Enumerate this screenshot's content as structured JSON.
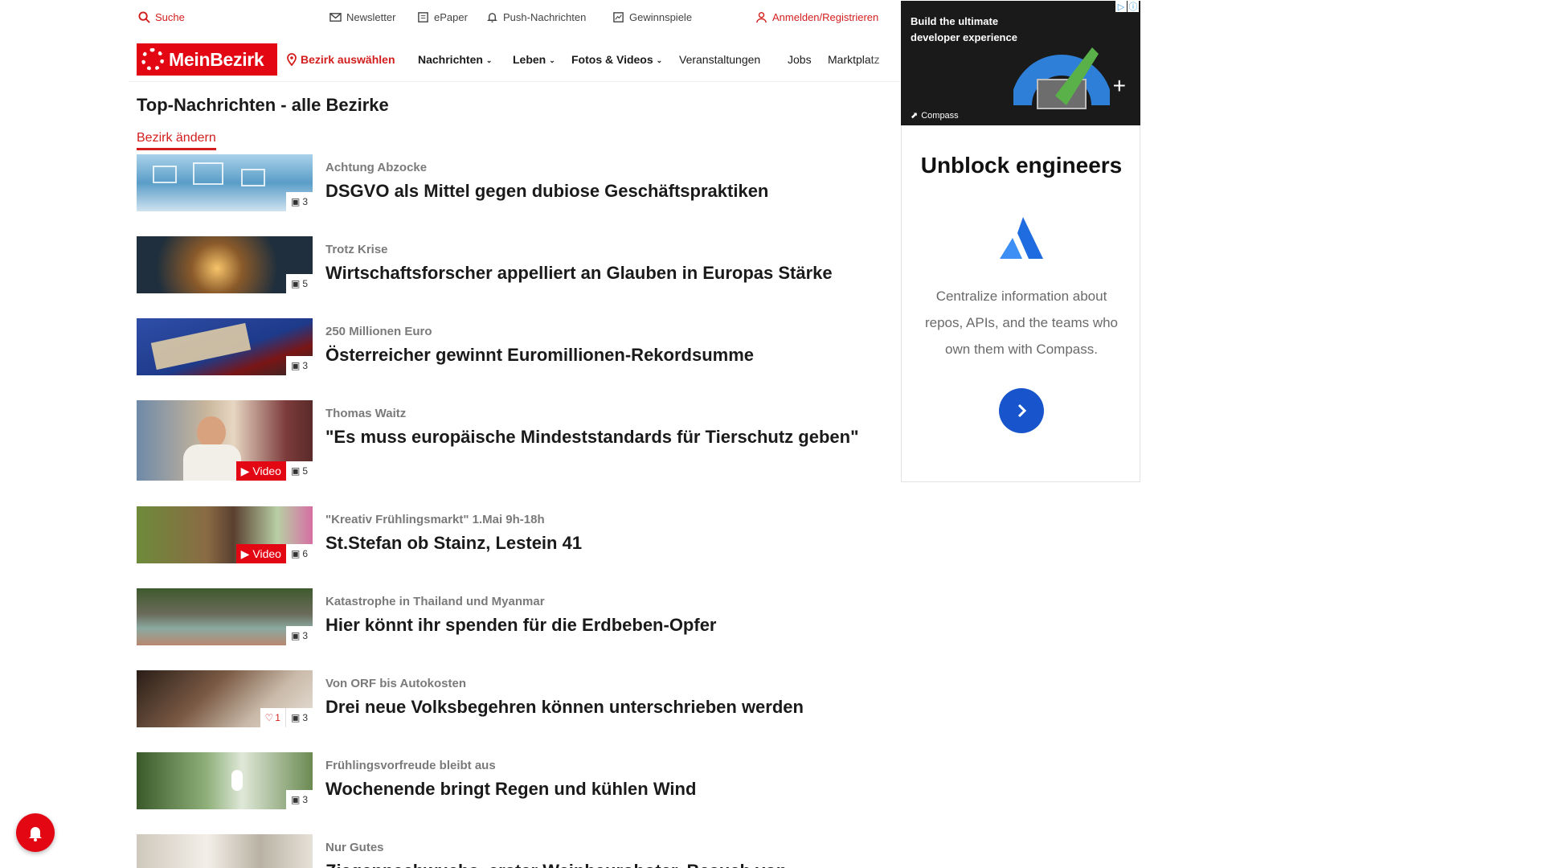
{
  "header": {
    "search_label": "Suche",
    "newsletter_label": "Newsletter",
    "epaper_label": "ePaper",
    "push_label": "Push-Nachrichten",
    "gewinnspiele_label": "Gewinnspiele",
    "login_label": "Anmelden/Registrieren"
  },
  "nav": {
    "logo_text": "MeinBezirk",
    "bezirk_select": "Bezirk auswählen",
    "items": [
      "Nachrichten",
      "Leben",
      "Fotos & Videos",
      "Veranstaltungen",
      "Jobs",
      "Marktplatz"
    ]
  },
  "section": {
    "title": "Top-Nachrichten - alle Bezirke",
    "change_link": "Bezirk ändern"
  },
  "articles": [
    {
      "kicker": "Achtung Abzocke",
      "headline": "DSGVO als Mittel gegen dubiose Geschäftspraktiken",
      "images": "3"
    },
    {
      "kicker": "Trotz Krise",
      "headline": "Wirtschaftsforscher appelliert an Glauben in Europas Stärke",
      "images": "5"
    },
    {
      "kicker": "250 Millionen Euro",
      "headline": "Österreicher gewinnt Euromillionen-Rekordsumme",
      "images": "3"
    },
    {
      "kicker": "Thomas Waitz",
      "headline": "\"Es muss europäische Mindeststandards für Tierschutz geben\"",
      "images": "5",
      "video": "Video"
    },
    {
      "kicker": "\"Kreativ Frühlingsmarkt\" 1.Mai 9h-18h",
      "headline": "St.Stefan ob Stainz, Lestein 41",
      "images": "6",
      "video": "Video"
    },
    {
      "kicker": "Katastrophe in Thailand und Myanmar",
      "headline": "Hier könnt ihr spenden für die Erdbeben-Opfer",
      "images": "3"
    },
    {
      "kicker": "Von ORF bis Autokosten",
      "headline": "Drei neue Volksbegehren können unterschrieben werden",
      "images": "3",
      "likes": "1"
    },
    {
      "kicker": "Frühlingsvorfreude bleibt aus",
      "headline": "Wochenende bringt Regen und kühlen Wind",
      "images": "3"
    },
    {
      "kicker": "Nur Gutes",
      "headline": "Ziegennachwuchs, erster Weinbauroboter, Besuch von"
    }
  ],
  "ad": {
    "top_text": "Build the ultimate developer experience",
    "brand": "Compass",
    "heading": "Unblock engineers",
    "body": "Centralize information about repos, APIs, and the teams who own them with Compass."
  },
  "colors": {
    "brand_red": "#e30613",
    "ad_blue": "#1855cc"
  }
}
